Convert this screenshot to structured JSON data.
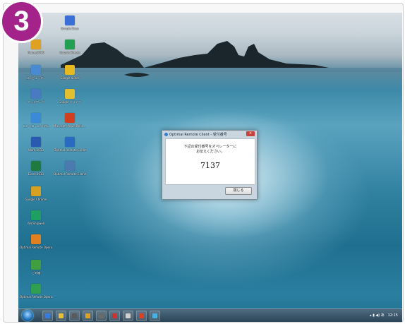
{
  "step_badge": "3",
  "desktop_icons": [
    {
      "label": "Google Docs",
      "color": "#3b6fd8"
    },
    {
      "label": "Muvee2009",
      "color": "#e0a020"
    },
    {
      "label": "Google Sheets",
      "color": "#20a050"
    },
    {
      "label": "コンピューター",
      "color": "#4a8ad0"
    },
    {
      "label": "Google Slides",
      "color": "#e8b820"
    },
    {
      "label": "ネットワーク",
      "color": "#4a7ac0"
    },
    {
      "label": "Google ドライブ",
      "color": "#e0c030"
    },
    {
      "label": "コントロール パネル",
      "color": "#3a8ad8"
    },
    {
      "label": "Microsoft PowerPoint ...",
      "color": "#d04020"
    },
    {
      "label": "Word 2013",
      "color": "#2a5ab0"
    },
    {
      "label": "Optimal Remote Client",
      "color": "#2a6ac0"
    },
    {
      "label": "Excel 2013",
      "color": "#1f7a3f"
    },
    {
      "label": "Optimal Remote Client(ショートカット)",
      "color": "#4a7ab0"
    },
    {
      "label": "Google Chrome",
      "color": "#d8a020"
    },
    {
      "label": "WinShipwell",
      "color": "#20a060"
    },
    {
      "label": "Optimal Remote Operator ...",
      "color": "#e08020"
    },
    {
      "label": "ごみ箱",
      "color": "#40a040"
    },
    {
      "label": "Optimal Remote Operator BASIC",
      "color": "#30a050"
    }
  ],
  "dialog": {
    "title": "Optimal Remote Client - 受付番号",
    "close": "×",
    "message_line1": "下記の受付番号をオペレーターに",
    "message_line2": "お伝えください。",
    "number": "7137",
    "button": "閉じる"
  },
  "taskbar": {
    "clock": "12:15",
    "tray_icons": "▴ ▮ ◀) あ",
    "colors": [
      "#3a7ad8",
      "#e8c030",
      "#5a5a5a",
      "#e0a020",
      "#6a6a6a",
      "#d03030",
      "#d0d0d0",
      "#e04020",
      "#4ab0e0"
    ]
  }
}
